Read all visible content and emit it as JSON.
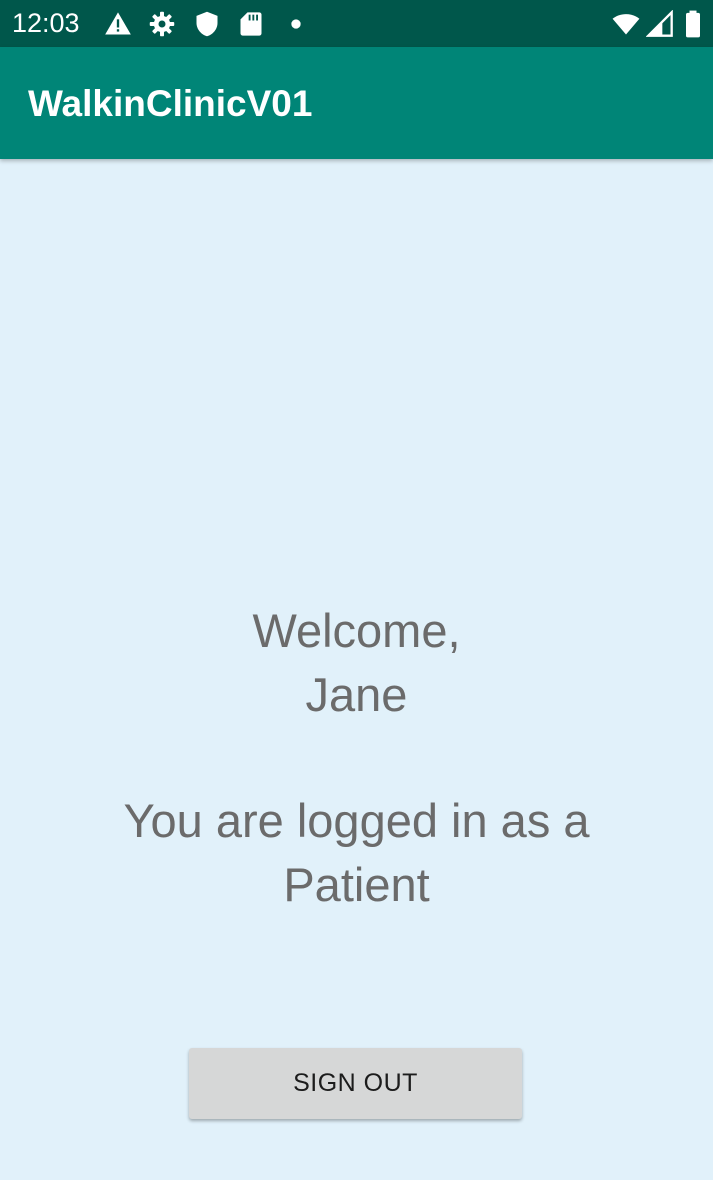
{
  "status_bar": {
    "time": "12:03",
    "left_icons": [
      "warning-icon",
      "gear-icon",
      "shield-icon",
      "sd-card-icon",
      "notification-dot-icon"
    ],
    "right_icons": [
      "wifi-icon",
      "cell-signal-icon",
      "battery-icon"
    ]
  },
  "app_bar": {
    "title": "WalkinClinicV01"
  },
  "main": {
    "welcome_line1": "Welcome,",
    "welcome_line2": "Jane",
    "role_line1": "You are logged in as a",
    "role_line2": "Patient",
    "sign_out_label": "SIGN OUT"
  },
  "colors": {
    "status_bar": "#00574b",
    "app_bar": "#008577",
    "background": "#e1f1fa",
    "text": "#6b6b6b",
    "button": "#d6d7d7"
  }
}
